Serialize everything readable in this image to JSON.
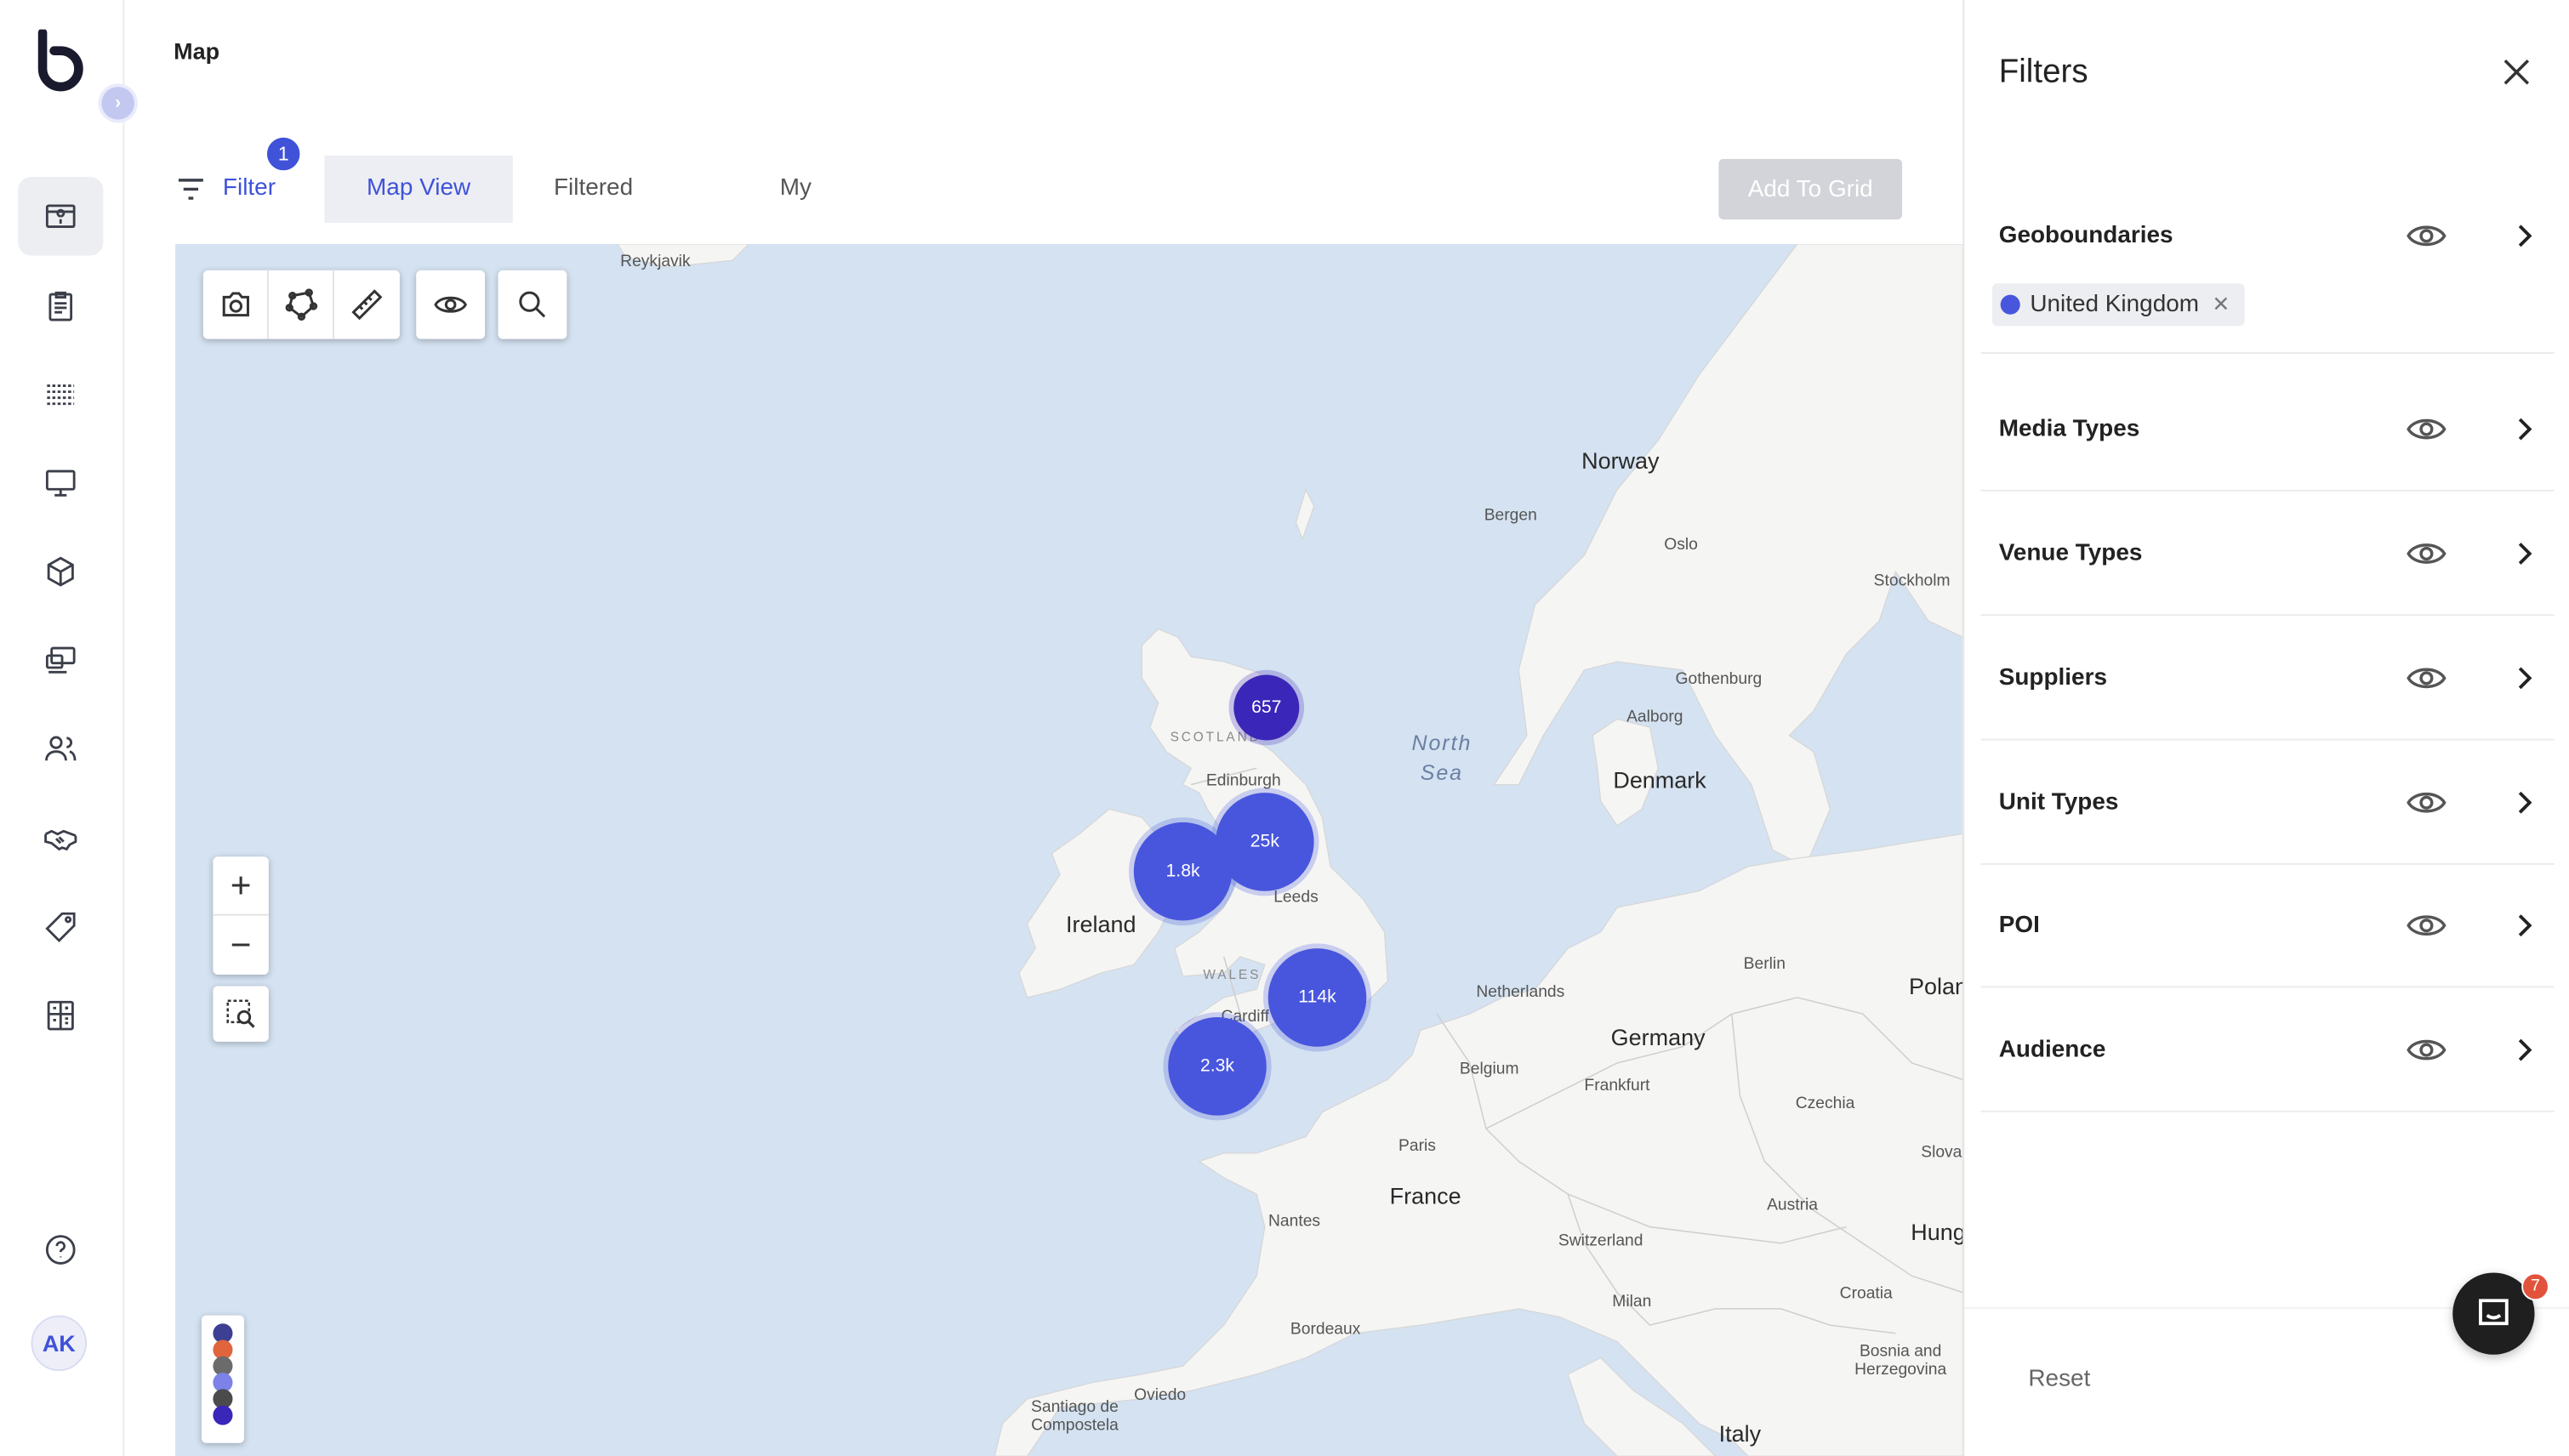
{
  "app": {
    "page_title": "Map",
    "sidebar_nav": [
      "map-icon",
      "clipboard-icon",
      "grid-lines-icon",
      "presentation-icon",
      "cube-icon",
      "devices-icon",
      "users-icon",
      "handshake-icon",
      "tag-icon",
      "calculator-icon"
    ],
    "help_icon": "help-circle-icon",
    "user_initials": "AK"
  },
  "tabs": {
    "filter_label": "Filter",
    "filter_badge": "1",
    "map_view": "Map View",
    "filtered_units": "Filtered Units",
    "my_grid": "My Grid",
    "active": "Map View"
  },
  "toolbar": {
    "add_to_grid": "Add To Grid",
    "tools": [
      "camera-icon",
      "polygon-draw-icon",
      "ruler-icon",
      "eye-icon",
      "search-icon"
    ]
  },
  "map": {
    "zoom_in": "+",
    "zoom_out": "−",
    "places": {
      "reykjavik": "Reykjavik",
      "norway": "Norway",
      "bergen": "Bergen",
      "oslo": "Oslo",
      "stockholm": "Stockholm",
      "gothenburg": "Gothenburg",
      "aalborg": "Aalborg",
      "denmark": "Denmark",
      "north_sea_1": "North",
      "north_sea_2": "Sea",
      "scotland": "SCOTLAND",
      "edinburgh": "Edinburgh",
      "leeds": "Leeds",
      "ireland": "Ireland",
      "wales": "WALES",
      "cardiff": "Cardiff",
      "netherlands": "Netherlands",
      "berlin": "Berlin",
      "poland": "Polan",
      "germany": "Germany",
      "belgium": "Belgium",
      "frankfurt": "Frankfurt",
      "czechia": "Czechia",
      "paris": "Paris",
      "slovakia": "Slova",
      "france": "France",
      "austria": "Austria",
      "nantes": "Nantes",
      "switzerland": "Switzerland",
      "hungary": "Hung",
      "milan": "Milan",
      "croatia": "Croatia",
      "bordeaux": "Bordeaux",
      "bosnia_1": "Bosnia and",
      "bosnia_2": "Herzegovina",
      "santiago_1": "Santiago de",
      "santiago_2": "Compostela",
      "oviedo": "Oviedo",
      "italy": "Italy"
    },
    "clusters": [
      "657",
      "25k",
      "1.8k",
      "114k",
      "2.3k"
    ],
    "legend_colors": [
      "#3d3f93",
      "#e0643c",
      "#6b6b6b",
      "#7c82e8",
      "#4b4b4b",
      "#3a26b8"
    ]
  },
  "filters": {
    "title": "Filters",
    "sections": [
      "Geoboundaries",
      "Media Types",
      "Venue Types",
      "Suppliers",
      "Unit Types",
      "POI",
      "Audience"
    ],
    "geoboundary_chip": "United Kingdom",
    "reset": "Reset"
  },
  "chat": {
    "badge": "7"
  }
}
